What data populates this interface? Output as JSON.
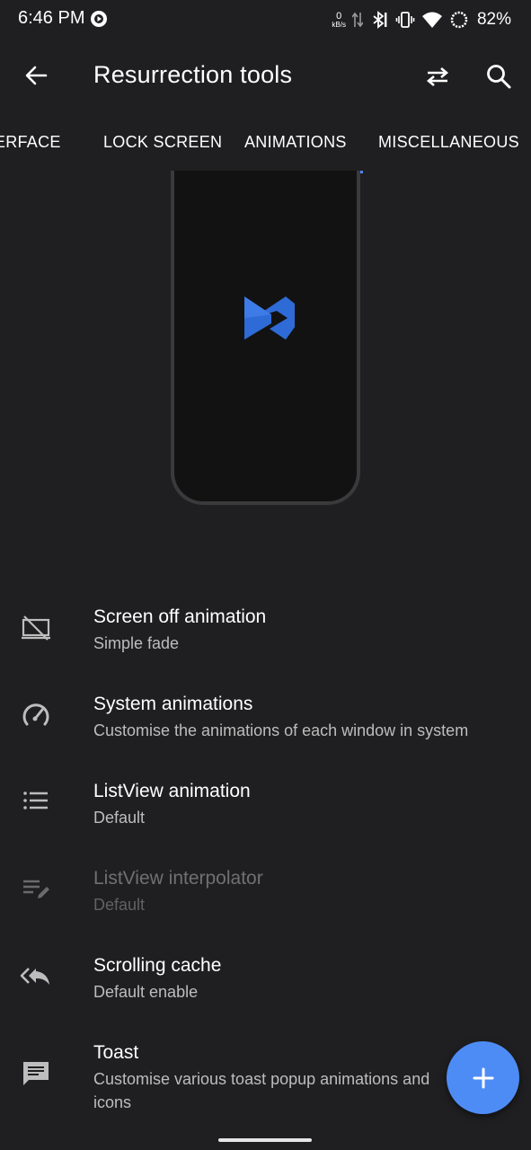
{
  "status_bar": {
    "time": "6:46 PM",
    "net_speed_value": "0",
    "net_speed_unit": "kB/s",
    "battery_percent": "82%",
    "icons": [
      "media-record-icon",
      "data-arrows-icon",
      "bluetooth-icon",
      "vibrate-icon",
      "wifi-icon",
      "battery-ring-icon"
    ]
  },
  "app_bar": {
    "title": "Resurrection tools",
    "icons": [
      "back-arrow-icon",
      "swap-icon",
      "search-icon"
    ]
  },
  "tabs": {
    "items": [
      "INTERFACE",
      "LOCK SCREEN",
      "ANIMATIONS",
      "MISCELLANEOUS"
    ],
    "selected": "ANIMATIONS",
    "indicator_color": "#4f86f0"
  },
  "preview": {
    "logo_icon": "resurrection-logo-icon",
    "logo_color": "#2f6bd6"
  },
  "settings": [
    {
      "title": "Screen off animation",
      "subtitle": "Simple fade",
      "icon": "screen-off-icon",
      "enabled": true
    },
    {
      "title": "System animations",
      "subtitle": "Customise the animations of each window in system",
      "icon": "speedometer-icon",
      "enabled": true
    },
    {
      "title": "ListView animation",
      "subtitle": "Default",
      "icon": "list-icon",
      "enabled": true
    },
    {
      "title": "ListView interpolator",
      "subtitle": "Default",
      "icon": "edit-list-icon",
      "enabled": false
    },
    {
      "title": "Scrolling cache",
      "subtitle": "Default enable",
      "icon": "reply-all-icon",
      "enabled": true
    },
    {
      "title": "Toast",
      "subtitle": "Customise various toast popup animations and icons",
      "icon": "toast-message-icon",
      "enabled": true
    }
  ],
  "fab": {
    "icon": "plus-icon",
    "color": "#4e8cf5"
  }
}
